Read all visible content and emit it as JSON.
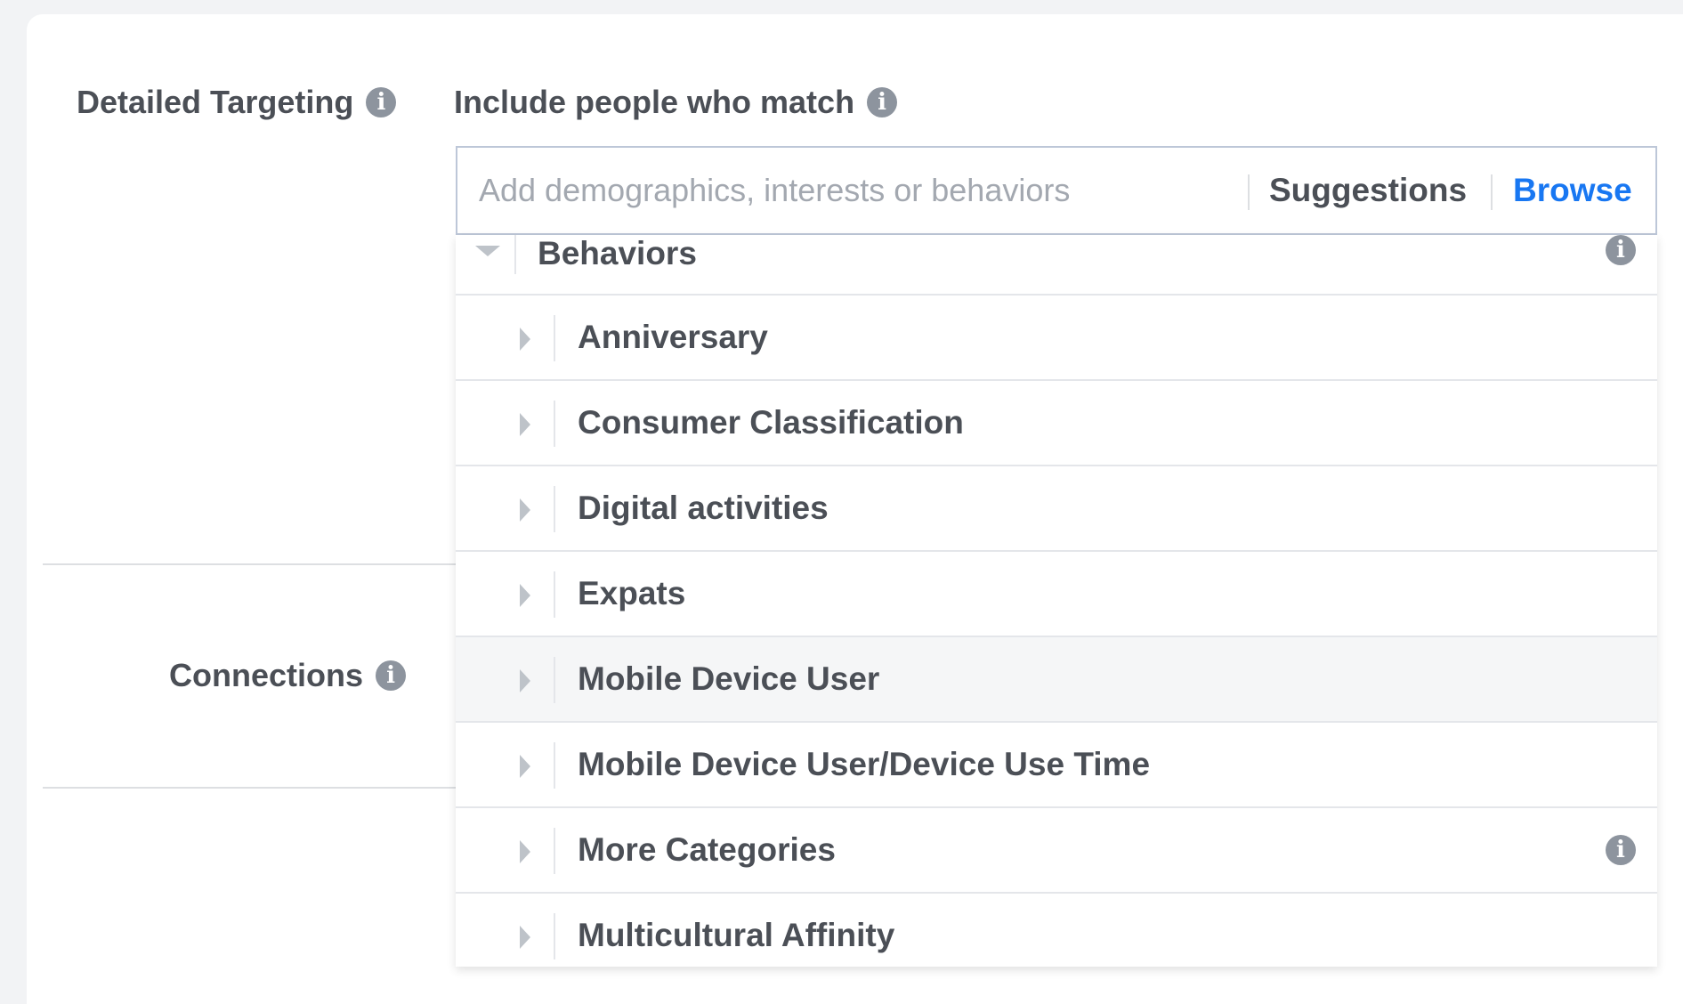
{
  "targeting": {
    "label": "Detailed Targeting",
    "include_label": "Include people who match",
    "search": {
      "placeholder": "Add demographics, interests or behaviors",
      "suggestions_label": "Suggestions",
      "browse_label": "Browse"
    },
    "dropdown": {
      "category": "Behaviors",
      "items": [
        {
          "label": "Anniversary",
          "has_info": false,
          "highlighted": false
        },
        {
          "label": "Consumer Classification",
          "has_info": false,
          "highlighted": false
        },
        {
          "label": "Digital activities",
          "has_info": false,
          "highlighted": false
        },
        {
          "label": "Expats",
          "has_info": false,
          "highlighted": false
        },
        {
          "label": "Mobile Device User",
          "has_info": false,
          "highlighted": true
        },
        {
          "label": "Mobile Device User/Device Use Time",
          "has_info": false,
          "highlighted": false
        },
        {
          "label": "More Categories",
          "has_info": true,
          "highlighted": false
        },
        {
          "label": "Multicultural Affinity",
          "has_info": false,
          "highlighted": false
        }
      ]
    }
  },
  "connections": {
    "label": "Connections"
  },
  "icons": {
    "info": "info-icon",
    "expand": "caret-right-icon",
    "collapse": "caret-down-icon"
  },
  "colors": {
    "link_blue": "#1877f2",
    "label_gray": "#4b4f56",
    "placeholder_gray": "#a3a8b0",
    "icon_gray": "#8d949e",
    "highlight_bg": "#f5f6f7"
  }
}
